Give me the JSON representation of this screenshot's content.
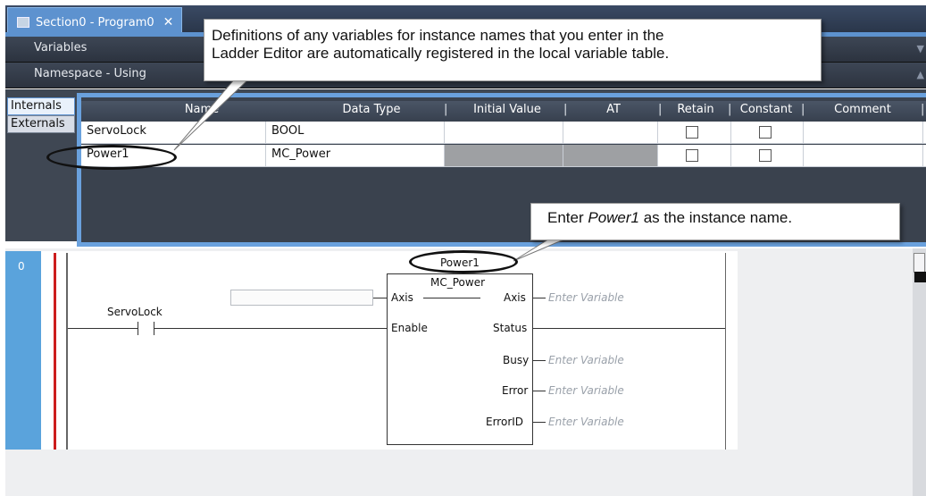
{
  "tab": {
    "title": "Section0 - Program0",
    "close": "✕"
  },
  "bars": {
    "variables": "Variables",
    "namespace": "Namespace - Using"
  },
  "side_tabs": [
    "Internals",
    "Externals"
  ],
  "table": {
    "columns": [
      "Name",
      "Data Type",
      "Initial Value",
      "AT",
      "Retain",
      "Constant",
      "Comment"
    ],
    "rows": [
      {
        "name": "ServoLock",
        "data_type": "BOOL"
      },
      {
        "name": "Power1",
        "data_type": "MC_Power"
      }
    ]
  },
  "ladder": {
    "rung_number": "0",
    "contact_label": "ServoLock",
    "fb_instance": "Power1",
    "fb_type": "MC_Power",
    "inputs": [
      "Axis",
      "Enable"
    ],
    "outputs": [
      "Axis",
      "Status",
      "Busy",
      "Error",
      "ErrorID"
    ],
    "placeholder": "Enter Variable"
  },
  "callouts": {
    "top_line1": "Definitions of any variables for instance names that you enter in the",
    "top_line2": "Ladder Editor are automatically registered in the local variable table.",
    "instance_pre": "Enter ",
    "instance_em": "Power1",
    "instance_post": " as the instance name."
  },
  "colors": {
    "accent": "#5d92cf",
    "rail_red": "#cc1d1d",
    "dark_bar": "#2c333f"
  }
}
